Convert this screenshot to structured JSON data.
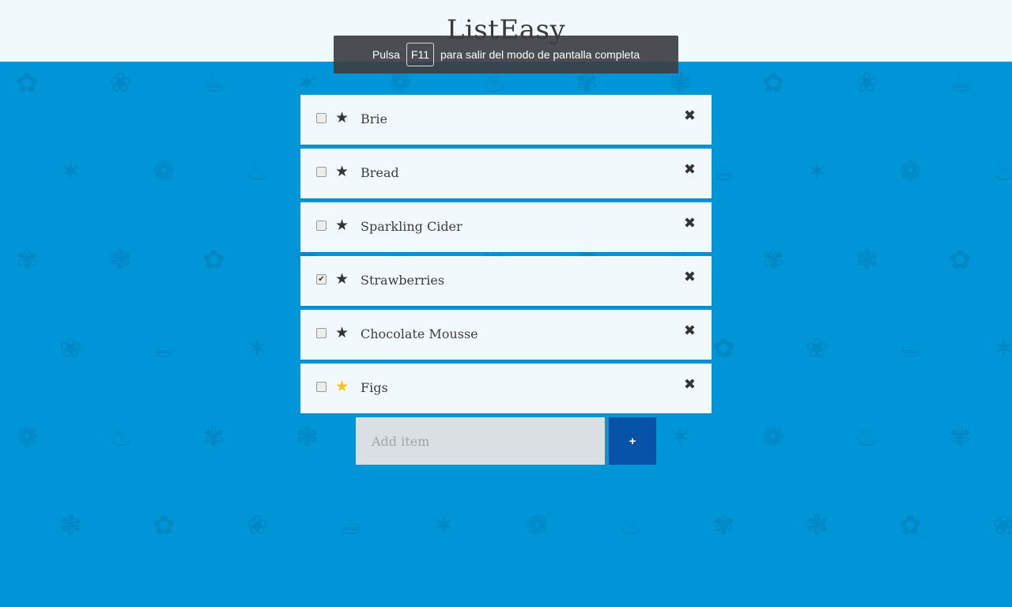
{
  "app": {
    "title": "ListEasy"
  },
  "fullscreen_notice": {
    "prefix": "Pulsa",
    "key": "F11",
    "suffix": "para salir del modo de pantalla completa"
  },
  "items": [
    {
      "label": "Brie",
      "checked": false,
      "starred": false
    },
    {
      "label": "Bread",
      "checked": false,
      "starred": false
    },
    {
      "label": "Sparkling Cider",
      "checked": false,
      "starred": false
    },
    {
      "label": "Strawberries",
      "checked": true,
      "starred": false
    },
    {
      "label": "Chocolate Mousse",
      "checked": false,
      "starred": false
    },
    {
      "label": "Figs",
      "checked": false,
      "starred": true
    }
  ],
  "icons": {
    "star": "star-icon",
    "delete": "close-icon",
    "check": "checkmark-icon"
  },
  "add": {
    "placeholder": "Add item",
    "button_label": "+"
  },
  "colors": {
    "background": "#0095d6",
    "card": "#f2f9fc",
    "add_button": "#0653a8",
    "star_active": "#f5c518",
    "text": "#3d3d3d"
  }
}
